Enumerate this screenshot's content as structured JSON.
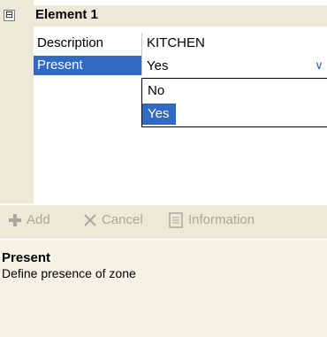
{
  "category": {
    "title": "Element 1",
    "expander": "⊟"
  },
  "properties": [
    {
      "name": "Description",
      "value": "KITCHEN"
    },
    {
      "name": "Present",
      "value": "Yes"
    }
  ],
  "dropdown": {
    "options": [
      "No",
      "Yes"
    ],
    "selected": "Yes"
  },
  "toolbar": {
    "add_label": "Add",
    "cancel_label": "Cancel",
    "info_label": "Information"
  },
  "help": {
    "title": "Present",
    "text": "Define presence of zone"
  },
  "colors": {
    "selection": "#316ac5",
    "panel": "#ece9d8",
    "help_bg": "#f5f3e6",
    "disabled": "#aca899"
  }
}
